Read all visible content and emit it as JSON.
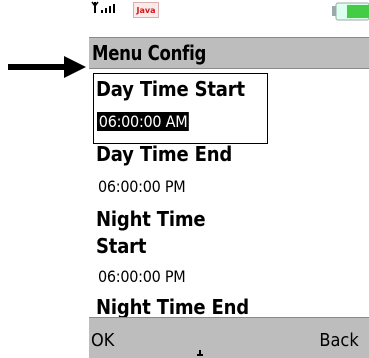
{
  "status_bar": {
    "signal_icon": "signal-bars-icon",
    "java_badge": "Java",
    "battery_icon": "battery-icon",
    "battery_color": "#44cc44"
  },
  "title": "Menu Config",
  "fields": [
    {
      "label": "Day Time Start",
      "value": "06:00:00 AM",
      "focused": true
    },
    {
      "label": "Day Time End",
      "value": "06:00:00 PM",
      "focused": false
    },
    {
      "label_line1": "Night Time",
      "label_line2": "Start",
      "value": "06:00:00 PM",
      "focused": false
    },
    {
      "label": "Night Time End",
      "focused": false
    }
  ],
  "soft_keys": {
    "left": "OK",
    "right": "Back"
  },
  "colors": {
    "title_bar": "#bdbdbd",
    "soft_bar": "#bdbdbd",
    "selection_bg": "#000000",
    "selection_fg": "#ffffff"
  }
}
